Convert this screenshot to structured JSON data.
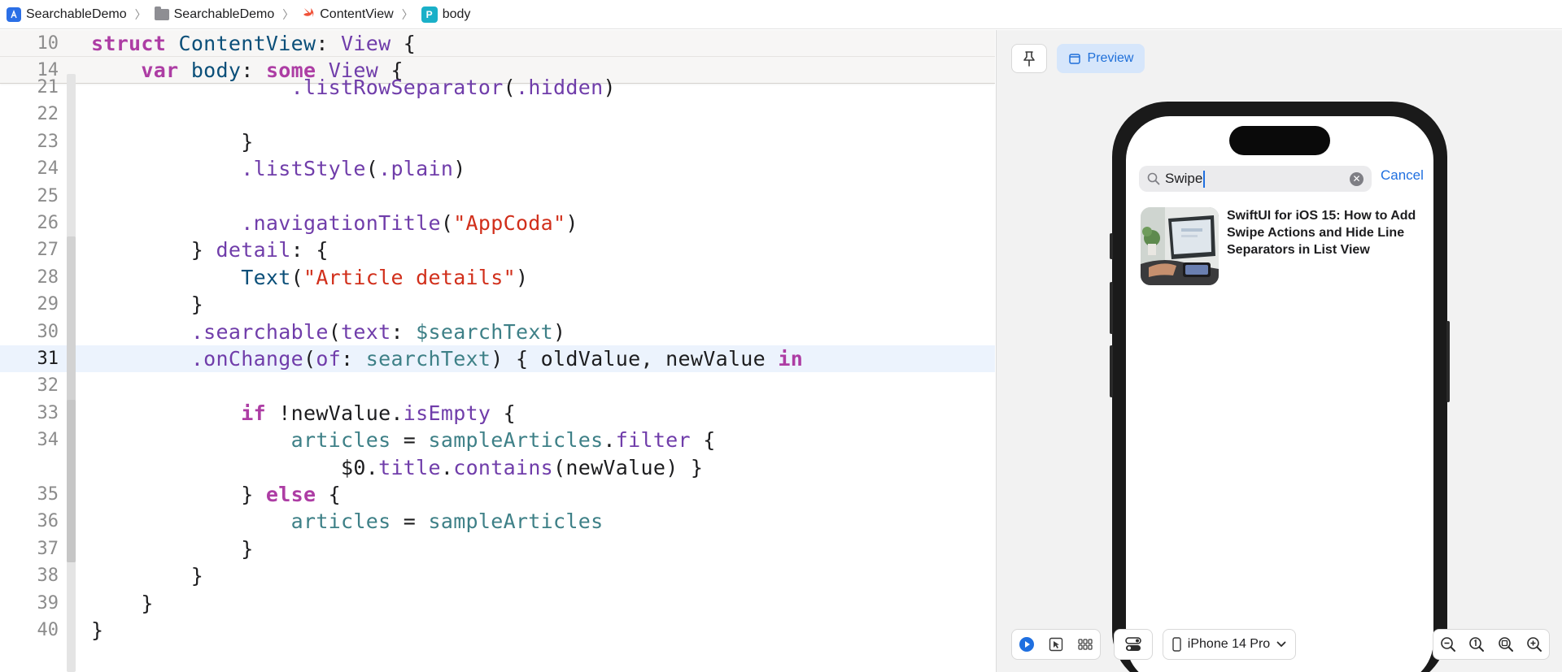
{
  "breadcrumb": {
    "items": [
      {
        "label": "SearchableDemo",
        "icon": "app-project-icon"
      },
      {
        "label": "SearchableDemo",
        "icon": "folder-icon"
      },
      {
        "label": "ContentView",
        "icon": "swift-file-icon"
      },
      {
        "label": "body",
        "icon": "property-p-icon",
        "badge": "P"
      }
    ]
  },
  "editor": {
    "sticky": [
      {
        "line": "10",
        "tokens": [
          {
            "t": "struct",
            "c": "kw"
          },
          {
            "t": " ",
            "c": "plain"
          },
          {
            "t": "ContentView",
            "c": "tyd"
          },
          {
            "t": ": ",
            "c": "plain"
          },
          {
            "t": "View",
            "c": "ty"
          },
          {
            "t": " {",
            "c": "plain"
          }
        ]
      },
      {
        "line": "14",
        "tokens": [
          {
            "t": "    ",
            "c": "plain"
          },
          {
            "t": "var",
            "c": "kw"
          },
          {
            "t": " ",
            "c": "plain"
          },
          {
            "t": "body",
            "c": "tyd"
          },
          {
            "t": ": ",
            "c": "plain"
          },
          {
            "t": "some",
            "c": "kw"
          },
          {
            "t": " ",
            "c": "plain"
          },
          {
            "t": "View",
            "c": "ty"
          },
          {
            "t": " {",
            "c": "plain"
          }
        ]
      }
    ],
    "current_line": "31",
    "lines": [
      {
        "line": "21",
        "tokens": [
          {
            "t": "                ",
            "c": "plain"
          },
          {
            "t": ".listRowSeparator",
            "c": "fn"
          },
          {
            "t": "(",
            "c": "plain"
          },
          {
            "t": ".hidden",
            "c": "fn"
          },
          {
            "t": ")",
            "c": "plain"
          }
        ]
      },
      {
        "line": "22",
        "tokens": []
      },
      {
        "line": "23",
        "tokens": [
          {
            "t": "            }",
            "c": "plain"
          }
        ]
      },
      {
        "line": "24",
        "tokens": [
          {
            "t": "            ",
            "c": "plain"
          },
          {
            "t": ".listStyle",
            "c": "fn"
          },
          {
            "t": "(",
            "c": "plain"
          },
          {
            "t": ".plain",
            "c": "fn"
          },
          {
            "t": ")",
            "c": "plain"
          }
        ]
      },
      {
        "line": "25",
        "tokens": []
      },
      {
        "line": "26",
        "tokens": [
          {
            "t": "            ",
            "c": "plain"
          },
          {
            "t": ".navigationTitle",
            "c": "fn"
          },
          {
            "t": "(",
            "c": "plain"
          },
          {
            "t": "\"AppCoda\"",
            "c": "str"
          },
          {
            "t": ")",
            "c": "plain"
          }
        ]
      },
      {
        "line": "27",
        "tokens": [
          {
            "t": "        } ",
            "c": "plain"
          },
          {
            "t": "detail",
            "c": "fn"
          },
          {
            "t": ": {",
            "c": "plain"
          }
        ]
      },
      {
        "line": "28",
        "tokens": [
          {
            "t": "            ",
            "c": "plain"
          },
          {
            "t": "Text",
            "c": "tyd"
          },
          {
            "t": "(",
            "c": "plain"
          },
          {
            "t": "\"Article details\"",
            "c": "str"
          },
          {
            "t": ")",
            "c": "plain"
          }
        ]
      },
      {
        "line": "29",
        "tokens": [
          {
            "t": "        }",
            "c": "plain"
          }
        ]
      },
      {
        "line": "30",
        "tokens": [
          {
            "t": "        ",
            "c": "plain"
          },
          {
            "t": ".searchable",
            "c": "fn"
          },
          {
            "t": "(",
            "c": "plain"
          },
          {
            "t": "text",
            "c": "fn"
          },
          {
            "t": ": ",
            "c": "plain"
          },
          {
            "t": "$searchText",
            "c": "prop"
          },
          {
            "t": ")",
            "c": "plain"
          }
        ]
      },
      {
        "line": "31",
        "tokens": [
          {
            "t": "        ",
            "c": "plain"
          },
          {
            "t": ".onChange",
            "c": "fn"
          },
          {
            "t": "(",
            "c": "plain"
          },
          {
            "t": "of",
            "c": "fn"
          },
          {
            "t": ": ",
            "c": "plain"
          },
          {
            "t": "searchText",
            "c": "prop"
          },
          {
            "t": ") { oldValue, newValue ",
            "c": "plain"
          },
          {
            "t": "in",
            "c": "kw"
          }
        ]
      },
      {
        "line": "32",
        "tokens": []
      },
      {
        "line": "33",
        "tokens": [
          {
            "t": "            ",
            "c": "plain"
          },
          {
            "t": "if",
            "c": "kw"
          },
          {
            "t": " !newValue.",
            "c": "plain"
          },
          {
            "t": "isEmpty",
            "c": "fn"
          },
          {
            "t": " {",
            "c": "plain"
          }
        ]
      },
      {
        "line": "34",
        "tokens": [
          {
            "t": "                ",
            "c": "plain"
          },
          {
            "t": "articles",
            "c": "prop"
          },
          {
            "t": " = ",
            "c": "plain"
          },
          {
            "t": "sampleArticles",
            "c": "prop"
          },
          {
            "t": ".",
            "c": "plain"
          },
          {
            "t": "filter",
            "c": "fn"
          },
          {
            "t": " {",
            "c": "plain"
          }
        ]
      },
      {
        "line": "",
        "tokens": [
          {
            "t": "                    $0.",
            "c": "plain"
          },
          {
            "t": "title",
            "c": "fn"
          },
          {
            "t": ".",
            "c": "plain"
          },
          {
            "t": "contains",
            "c": "fn"
          },
          {
            "t": "(newValue) }",
            "c": "plain"
          }
        ]
      },
      {
        "line": "35",
        "tokens": [
          {
            "t": "            } ",
            "c": "plain"
          },
          {
            "t": "else",
            "c": "kw"
          },
          {
            "t": " {",
            "c": "plain"
          }
        ]
      },
      {
        "line": "36",
        "tokens": [
          {
            "t": "                ",
            "c": "plain"
          },
          {
            "t": "articles",
            "c": "prop"
          },
          {
            "t": " = ",
            "c": "plain"
          },
          {
            "t": "sampleArticles",
            "c": "prop"
          }
        ]
      },
      {
        "line": "37",
        "tokens": [
          {
            "t": "            }",
            "c": "plain"
          }
        ]
      },
      {
        "line": "38",
        "tokens": [
          {
            "t": "        }",
            "c": "plain"
          }
        ]
      },
      {
        "line": "39",
        "tokens": [
          {
            "t": "    }",
            "c": "plain"
          }
        ]
      },
      {
        "line": "40",
        "tokens": [
          {
            "t": "}",
            "c": "plain"
          }
        ]
      }
    ]
  },
  "preview": {
    "pin_icon": "pin-icon",
    "tab_label": "Preview",
    "tab_icon": "preview-window-icon",
    "search": {
      "value": "Swipe",
      "icon": "magnifier-icon",
      "clear_icon": "clear-circle-icon",
      "cancel_label": "Cancel"
    },
    "result": {
      "title": "SwiftUI for iOS 15: How to Add Swipe Actions and Hide Line Separators in List View"
    },
    "controls": {
      "live_icon": "play-live-icon",
      "select_icon": "selectable-cursor-icon",
      "variants_icon": "variants-grid-icon",
      "settings_icon": "device-settings-icon",
      "device_icon": "iphone-icon",
      "device_label": "iPhone 14 Pro",
      "device_chevron": "chevron-down-icon",
      "zoom_out_icon": "zoom-out-icon",
      "zoom_100_icon": "zoom-actual-size-icon",
      "zoom_fit_icon": "zoom-to-fit-icon",
      "zoom_in_icon": "zoom-in-icon"
    }
  },
  "colors": {
    "keyword": "#ad3da4",
    "type": "#703daa",
    "string": "#d12f1b",
    "property": "#3e8087",
    "accent": "#1f6fe0",
    "current_line": "#ecf3fd"
  }
}
